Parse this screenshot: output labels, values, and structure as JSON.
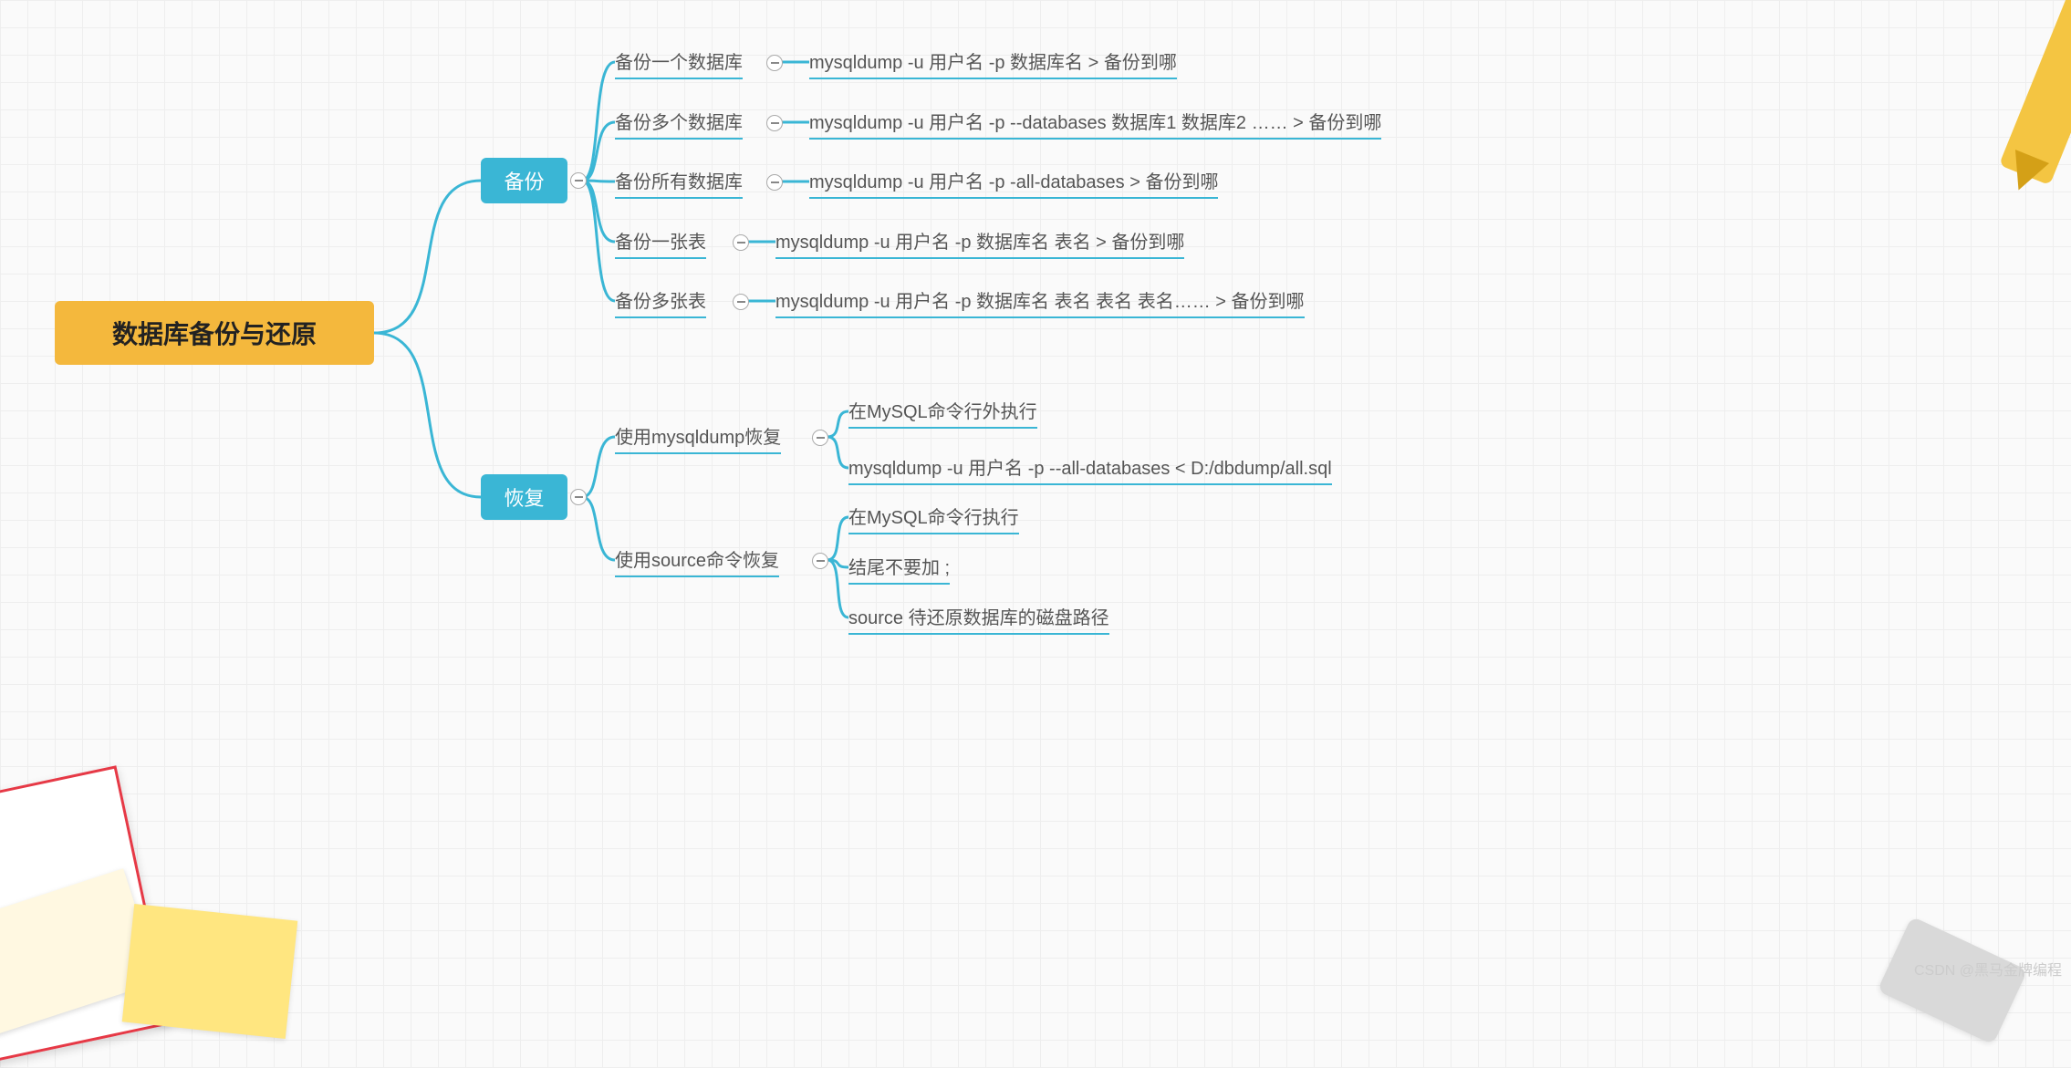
{
  "root": {
    "title": "数据库备份与还原"
  },
  "branch": {
    "backup": "备份",
    "restore": "恢复"
  },
  "backup_items": {
    "i0": {
      "label": "备份一个数据库",
      "cmd": "mysqldump -u 用户名 -p 数据库名 > 备份到哪"
    },
    "i1": {
      "label": "备份多个数据库",
      "cmd": "mysqldump -u 用户名 -p --databases 数据库1 数据库2 …… > 备份到哪"
    },
    "i2": {
      "label": "备份所有数据库",
      "cmd": "mysqldump -u 用户名 -p -all-databases > 备份到哪"
    },
    "i3": {
      "label": "备份一张表",
      "cmd": "mysqldump -u 用户名 -p 数据库名 表名 > 备份到哪"
    },
    "i4": {
      "label": "备份多张表",
      "cmd": "mysqldump -u 用户名 -p 数据库名 表名 表名 表名…… > 备份到哪"
    }
  },
  "restore_items": {
    "r0": {
      "label": "使用mysqldump恢复",
      "sub": {
        "s0": "在MySQL命令行外执行",
        "s1": "mysqldump -u 用户名 -p --all-databases < D:/dbdump/all.sql"
      }
    },
    "r1": {
      "label": "使用source命令恢复",
      "sub": {
        "s0": "在MySQL命令行执行",
        "s1": "结尾不要加 ;",
        "s2": "source 待还原数据库的磁盘路径"
      }
    }
  },
  "watermark": "CSDN @黑马金牌编程"
}
